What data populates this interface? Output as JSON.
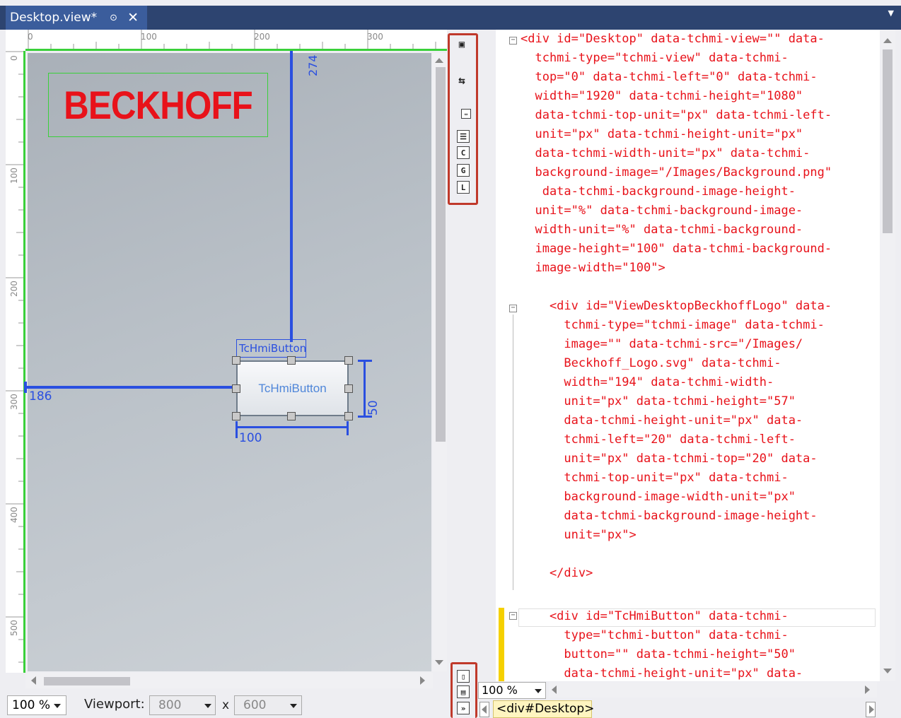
{
  "document_tab": {
    "title": "Desktop.view*",
    "pin_icon": "pin-icon",
    "close_icon": "close-icon"
  },
  "ruler": {
    "top_ticks": [
      "0",
      "100",
      "200",
      "300"
    ],
    "left_ticks": [
      "0",
      "100",
      "200",
      "300",
      "400",
      "500"
    ]
  },
  "designer": {
    "logo_text": "BECKHOFF",
    "logo_color": "#e8121a",
    "top_distance": "274",
    "left_distance": "186",
    "button_tag": "TcHmiButton",
    "button_text": "TcHmiButton",
    "button_width": "100",
    "button_height": "50",
    "guide_color": "#2a4fe0"
  },
  "toolbar": {
    "buttons": [
      "C",
      "G",
      "L"
    ],
    "bottom_buttons": [
      "split-vertical-icon",
      "split-horizontal-icon",
      "collapse-pane-icon"
    ]
  },
  "code": {
    "lines": [
      "<div id=\"Desktop\" data-tchmi-view=\"\" data-",
      "  tchmi-type=\"tchmi-view\" data-tchmi-",
      "  top=\"0\" data-tchmi-left=\"0\" data-tchmi-",
      "  width=\"1920\" data-tchmi-height=\"1080\"",
      "  data-tchmi-top-unit=\"px\" data-tchmi-left-",
      "  unit=\"px\" data-tchmi-height-unit=\"px\"",
      "  data-tchmi-width-unit=\"px\" data-tchmi-",
      "  background-image=\"/Images/Background.png\"",
      "   data-tchmi-background-image-height-",
      "  unit=\"%\" data-tchmi-background-image-",
      "  width-unit=\"%\" data-tchmi-background-",
      "  image-height=\"100\" data-tchmi-background-",
      "  image-width=\"100\">",
      "",
      "    <div id=\"ViewDesktopBeckhoffLogo\" data-",
      "      tchmi-type=\"tchmi-image\" data-tchmi-",
      "      image=\"\" data-tchmi-src=\"/Images/",
      "      Beckhoff_Logo.svg\" data-tchmi-",
      "      width=\"194\" data-tchmi-width-",
      "      unit=\"px\" data-tchmi-height=\"57\"",
      "      data-tchmi-height-unit=\"px\" data-",
      "      tchmi-left=\"20\" data-tchmi-left-",
      "      unit=\"px\" data-tchmi-top=\"20\" data-",
      "      tchmi-top-unit=\"px\" data-tchmi-",
      "      background-image-width-unit=\"px\"",
      "      data-tchmi-background-image-height-",
      "      unit=\"px\">",
      "",
      "    </div>",
      "",
      "    <div id=\"TcHmiButton\" data-tchmi-",
      "      type=\"tchmi-button\" data-tchmi-",
      "      button=\"\" data-tchmi-height=\"50\"",
      "      data-tchmi-height-unit=\"px\" data-"
    ],
    "zoom": "100 %",
    "breadcrumb": "<div#Desktop>"
  },
  "statusbar": {
    "zoom": "100 %",
    "viewport_label": "Viewport:",
    "viewport_width": "800",
    "viewport_x": "x",
    "viewport_height": "600"
  }
}
